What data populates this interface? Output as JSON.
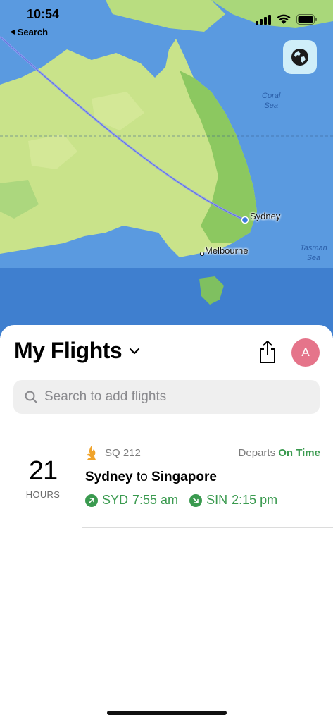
{
  "status_bar": {
    "time": "10:54",
    "back_label": "Search"
  },
  "map": {
    "labels": {
      "sydney": "Sydney",
      "melbourne": "Melbourne",
      "coral_sea": "Coral\nSea",
      "tasman_sea": "Tasman\nSea"
    },
    "colors": {
      "ocean": "#4f8fd8",
      "land": "#c9e38a",
      "land_dark": "#8cc860",
      "route": "#7a8de8"
    }
  },
  "sheet": {
    "title": "My Flights",
    "avatar_initial": "A",
    "search_placeholder": "Search to add flights"
  },
  "flight": {
    "countdown_value": "21",
    "countdown_unit": "HOURS",
    "flight_code": "SQ 212",
    "departs_label": "Departs",
    "departs_status": "On Time",
    "origin_city": "Sydney",
    "route_connector": "to",
    "destination_city": "Singapore",
    "origin_code": "SYD",
    "origin_time": "7:55 am",
    "destination_code": "SIN",
    "destination_time": "2:15 pm",
    "status_color": "#3a9a4f"
  }
}
